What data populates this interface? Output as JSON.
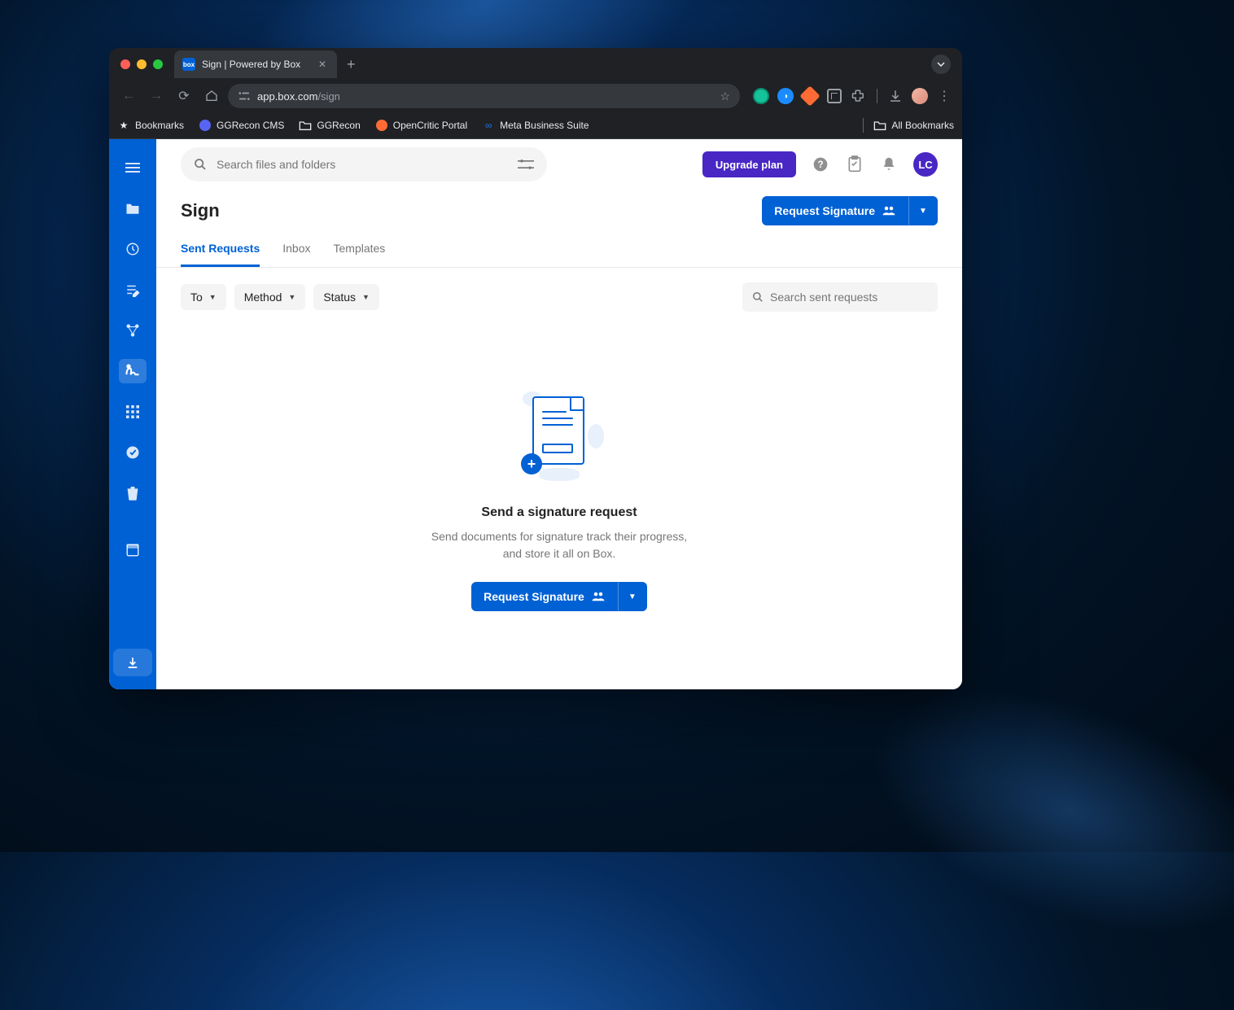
{
  "browser": {
    "tab_title": "Sign | Powered by Box",
    "url_host": "app.box.com",
    "url_path": "/sign",
    "bookmarks": [
      {
        "label": "Bookmarks",
        "icon": "star"
      },
      {
        "label": "GGRecon CMS",
        "icon": "dot-blue"
      },
      {
        "label": "GGRecon",
        "icon": "folder"
      },
      {
        "label": "OpenCritic Portal",
        "icon": "dot-orange"
      },
      {
        "label": "Meta Business Suite",
        "icon": "infinity"
      }
    ],
    "all_bookmarks": "All Bookmarks"
  },
  "search": {
    "placeholder": "Search files and folders"
  },
  "header": {
    "upgrade": "Upgrade plan",
    "avatar": "LC"
  },
  "page": {
    "title": "Sign",
    "request_signature": "Request Signature"
  },
  "tabs": [
    {
      "label": "Sent Requests",
      "active": true
    },
    {
      "label": "Inbox",
      "active": false
    },
    {
      "label": "Templates",
      "active": false
    }
  ],
  "filters": [
    {
      "label": "To"
    },
    {
      "label": "Method"
    },
    {
      "label": "Status"
    }
  ],
  "search_requests": {
    "placeholder": "Search sent requests"
  },
  "empty": {
    "title": "Send a signature request",
    "desc": "Send documents for signature track their progress, and store it all on Box.",
    "button": "Request Signature"
  }
}
